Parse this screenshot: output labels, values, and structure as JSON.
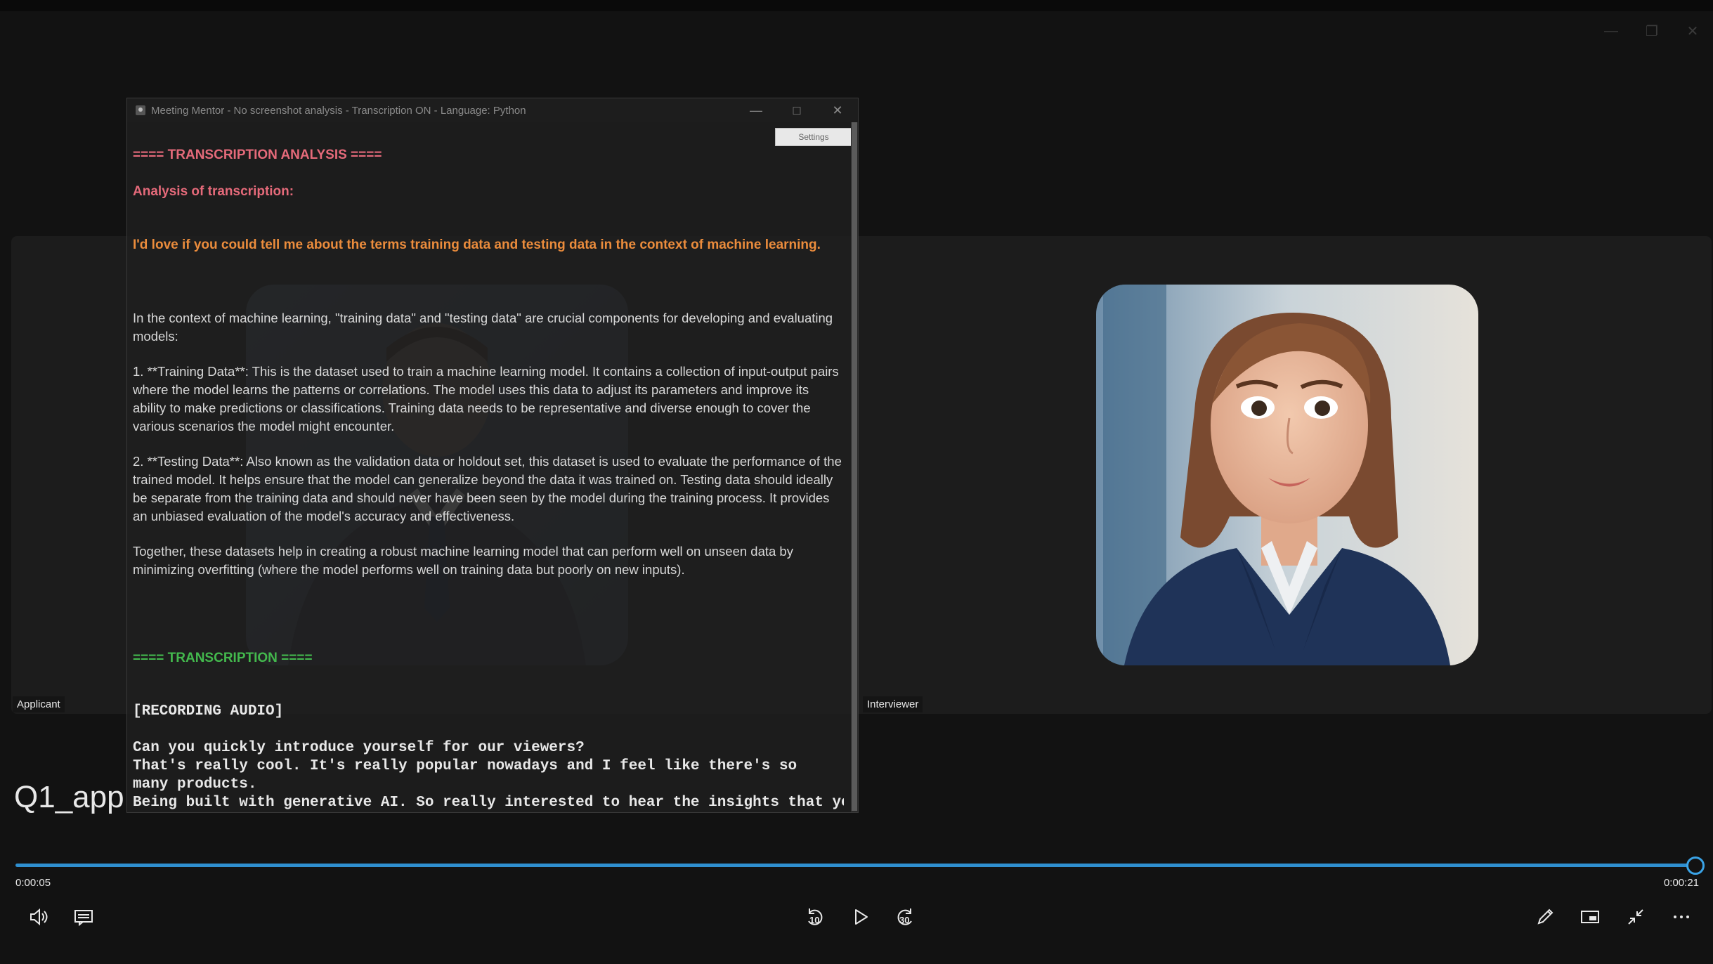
{
  "player": {
    "video_title": "Q1_app",
    "current_time": "0:00:05",
    "total_time": "0:00:21",
    "progress_fraction": 0.99,
    "accent_color": "#2f8fd0"
  },
  "tiles": {
    "applicant_label": "Applicant",
    "interviewer_label": "Interviewer"
  },
  "mentor": {
    "title": "Meeting Mentor - No screenshot analysis - Transcription ON - Language: Python",
    "settings_label": "Settings",
    "analysis_header": "==== TRANSCRIPTION ANALYSIS ====",
    "analysis_subheader": "Analysis of transcription:",
    "question": "I'd love if you could tell me about the terms training data and testing data in the context of machine learning.",
    "answer_intro": "In the context of machine learning, \"training data\" and \"testing data\" are crucial components for developing and evaluating models:",
    "answer_point1": "1. **Training Data**: This is the dataset used to train a machine learning model. It contains a collection of input-output pairs where the model learns the patterns or correlations. The model uses this data to adjust its parameters and improve its ability to make predictions or classifications. Training data needs to be representative and diverse enough to cover the various scenarios the model might encounter.",
    "answer_point2": "2. **Testing Data**: Also known as the validation data or holdout set, this dataset is used to evaluate the performance of the trained model. It helps ensure that the model can generalize beyond the data it was trained on. Testing data should ideally be separate from the training data and should never have been seen by the model during the training process. It provides an unbiased evaluation of the model's accuracy and effectiveness.",
    "answer_outro": "Together, these datasets help in creating a robust machine learning model that can perform well on unseen data by minimizing overfitting (where the model performs well on training data but poorly on new inputs).",
    "transcription_header": "==== TRANSCRIPTION ====",
    "recording_status": "[RECORDING AUDIO]",
    "transcript_line1": "Can you quickly introduce yourself for our viewers?",
    "transcript_line2": "That's really cool. It's really popular nowadays and I feel like there's so many products.",
    "transcript_line3": "Being built with generative AI. So really interested to hear the insights that you"
  },
  "controls": {
    "skip_back_seconds": "10",
    "skip_forward_seconds": "30",
    "icons": [
      "volume-icon",
      "captions-icon",
      "skip-back-icon",
      "play-icon",
      "skip-forward-icon",
      "edit-icon",
      "miniplayer-icon",
      "exit-fullscreen-icon",
      "more-icon"
    ]
  }
}
